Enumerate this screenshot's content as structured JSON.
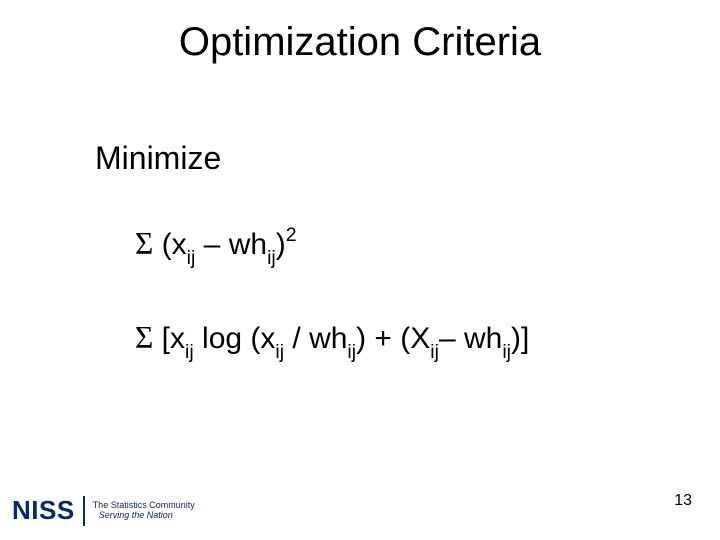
{
  "title": "Optimization Criteria",
  "subheading": "Minimize",
  "formulas": {
    "f1": {
      "sigma": "Σ",
      "open": " (x",
      "sub1": "ij",
      "mid": " – wh",
      "sub2": "ij",
      "close": ")",
      "sup": "2"
    },
    "f2": {
      "sigma": "Σ",
      "open": " [x",
      "sub1": "ij",
      "log": " log (x",
      "sub2": "ij",
      "over": " / wh",
      "sub3": "ij",
      "mid": ") + (X",
      "sub4": "ij",
      "minus": "– wh",
      "sub5": "ij",
      "close": ")]"
    }
  },
  "footer": {
    "logo": "NISS",
    "tagline1": "The Statistics Community",
    "tagline2": "Serving the Nation"
  },
  "page_number": "13"
}
